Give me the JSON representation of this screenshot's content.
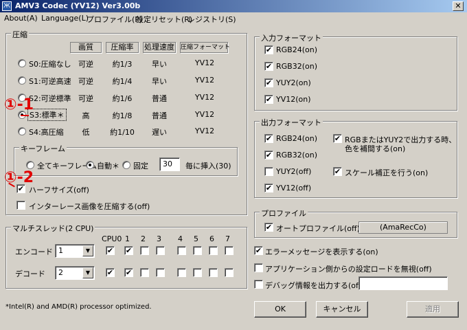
{
  "window": {
    "title": "AMV3 Codec (YV12) Ver3.00b",
    "icon_glyph": "Ж",
    "close_glyph": "✕"
  },
  "menu": [
    "About(A)",
    "Language(L)",
    "プロファイル(P)",
    "設定リセット(R)",
    "レジストリ(S)"
  ],
  "compression": {
    "title": "圧縮",
    "headers": [
      "画質",
      "圧縮率",
      "処理速度",
      "圧縮フォーマット"
    ],
    "rows": [
      {
        "label": "S0:圧縮なし",
        "quality": "可逆",
        "ratio": "約1/3",
        "speed": "早い",
        "format": "YV12",
        "selected": false
      },
      {
        "label": "S1:可逆高速",
        "quality": "可逆",
        "ratio": "約1/4",
        "speed": "早い",
        "format": "YV12",
        "selected": false
      },
      {
        "label": "S2:可逆標準",
        "quality": "可逆",
        "ratio": "約1/6",
        "speed": "普通",
        "format": "YV12",
        "selected": false
      },
      {
        "label": "S3:標準＊",
        "quality": "高",
        "ratio": "約1/8",
        "speed": "普通",
        "format": "YV12",
        "selected": true
      },
      {
        "label": "S4:高圧縮",
        "quality": "低",
        "ratio": "約1/10",
        "speed": "遅い",
        "format": "YV12",
        "selected": false
      }
    ],
    "keyframe": {
      "title": "キーフレーム",
      "options": [
        "全てキーフレーム",
        "自動＊",
        "固定"
      ],
      "selected": 1,
      "interval": "30",
      "interval_label": "毎に挿入(30)"
    },
    "half_size": {
      "label": "ハーフサイズ(off)",
      "checked": true
    },
    "interlace": {
      "label": "インターレース画像を圧縮する(off)",
      "checked": false
    }
  },
  "multithread": {
    "title": "マルチスレッド(2 CPU)",
    "cpu_labels": [
      "CPU0",
      "1",
      "2",
      "3",
      "4",
      "5",
      "6",
      "7"
    ],
    "encode": {
      "label": "エンコード",
      "value": "1",
      "checks": [
        true,
        true,
        false,
        false,
        false,
        false,
        false,
        false
      ]
    },
    "decode": {
      "label": "デコード",
      "value": "2",
      "checks": [
        true,
        true,
        false,
        false,
        false,
        false,
        false,
        false
      ]
    }
  },
  "footnote": "*Intel(R) and AMD(R) processor optimized.",
  "input_format": {
    "title": "入力フォーマット",
    "items": [
      {
        "label": "RGB24(on)",
        "checked": true
      },
      {
        "label": "RGB32(on)",
        "checked": true
      },
      {
        "label": "YUY2(on)",
        "checked": true
      },
      {
        "label": "YV12(on)",
        "checked": true
      }
    ]
  },
  "output_format": {
    "title": "出力フォーマット",
    "items": [
      {
        "label": "RGB24(on)",
        "checked": true
      },
      {
        "label": "RGB32(on)",
        "checked": true
      },
      {
        "label": "YUY2(off)",
        "checked": false
      },
      {
        "label": "YV12(off)",
        "checked": true
      }
    ],
    "rgb_fix": {
      "label1": "RGBまたはYUY2で出力する時、",
      "label2": "色を補間する(on)",
      "checked": true
    },
    "scale_fix": {
      "label": "スケール補正を行う(on)",
      "checked": true
    }
  },
  "profile": {
    "title": "プロファイル",
    "auto": {
      "label": "オートプロファイル(off)",
      "checked": true
    },
    "name": "(AmaRecCo)"
  },
  "options": [
    {
      "label": "エラーメッセージを表示する(on)",
      "checked": true
    },
    {
      "label": "アプリケーション側からの設定ロードを無視(off)",
      "checked": false
    },
    {
      "label": "デバッグ情報を出力する(off)",
      "checked": false
    }
  ],
  "debug_path": "",
  "buttons": {
    "ok": "OK",
    "cancel": "キャンセル",
    "apply": "適用"
  },
  "annotations": {
    "a1": "①-1",
    "a2": "①-2",
    "color": "#e00000"
  },
  "check_glyph": "✔",
  "arrow_glyph": "▼"
}
